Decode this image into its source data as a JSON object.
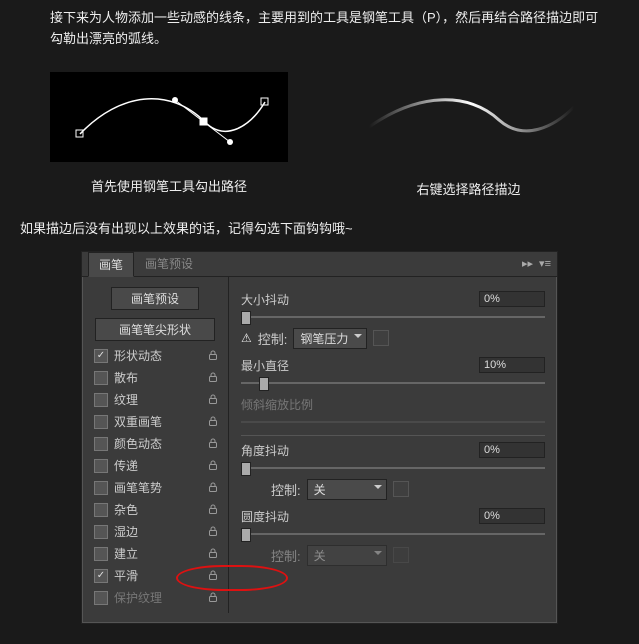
{
  "intro": "接下来为人物添加一些动感的线条，主要用到的工具是钢笔工具（P），然后再结合路径描边即可勾勒出漂亮的弧线。",
  "demo1_caption": "首先使用钢笔工具勾出路径",
  "demo2_caption": "右键选择路径描边",
  "note": "如果描边后没有出现以上效果的话，记得勾选下面钩钩哦~",
  "tabs": {
    "brush": "画笔",
    "preset": "画笔预设"
  },
  "preset_btn": "画笔预设",
  "tip_shape": "画笔笔尖形状",
  "options": [
    {
      "label": "形状动态",
      "checked": true,
      "locked": true,
      "dim": false
    },
    {
      "label": "散布",
      "checked": false,
      "locked": true,
      "dim": false
    },
    {
      "label": "纹理",
      "checked": false,
      "locked": true,
      "dim": false
    },
    {
      "label": "双重画笔",
      "checked": false,
      "locked": true,
      "dim": false
    },
    {
      "label": "颜色动态",
      "checked": false,
      "locked": true,
      "dim": false
    },
    {
      "label": "传递",
      "checked": false,
      "locked": true,
      "dim": false
    },
    {
      "label": "画笔笔势",
      "checked": false,
      "locked": true,
      "dim": false
    },
    {
      "label": "杂色",
      "checked": false,
      "locked": true,
      "dim": false
    },
    {
      "label": "湿边",
      "checked": false,
      "locked": true,
      "dim": false
    },
    {
      "label": "建立",
      "checked": false,
      "locked": true,
      "dim": false
    },
    {
      "label": "平滑",
      "checked": true,
      "locked": true,
      "dim": false
    },
    {
      "label": "保护纹理",
      "checked": false,
      "locked": true,
      "dim": true
    }
  ],
  "right": {
    "size_jitter": "大小抖动",
    "size_jitter_val": "0%",
    "control_lbl": "控制:",
    "control_val1": "钢笔压力",
    "min_diam": "最小直径",
    "min_diam_val": "10%",
    "tilt_scale": "倾斜缩放比例",
    "angle_jitter": "角度抖动",
    "angle_jitter_val": "0%",
    "control_val2": "关",
    "round_jitter": "圆度抖动",
    "round_jitter_val": "0%",
    "control_val3": "关"
  }
}
